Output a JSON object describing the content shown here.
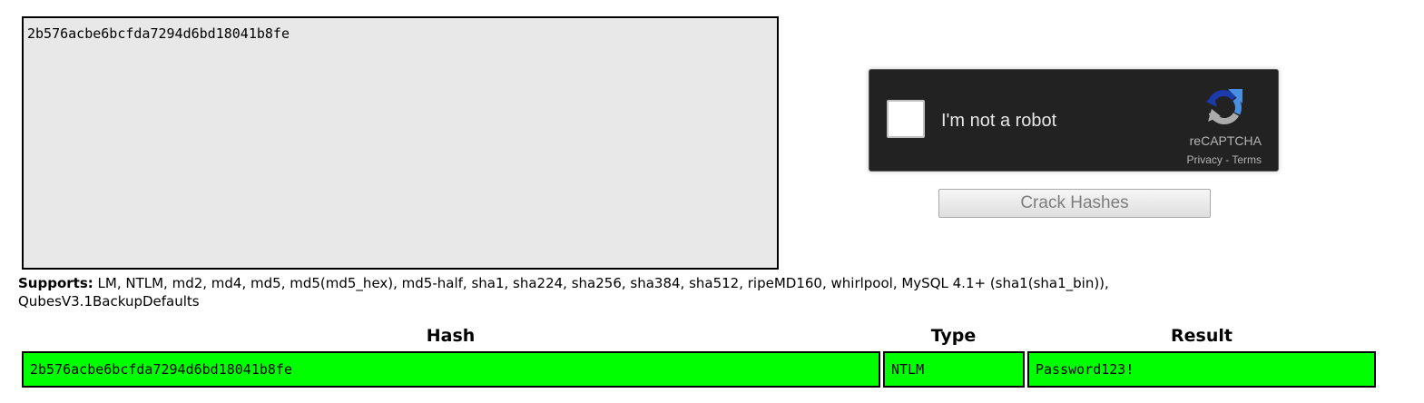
{
  "hash_input": {
    "value": "2b576acbe6bcfda7294d6bd18041b8fe"
  },
  "captcha": {
    "label": "I'm not a robot",
    "brand": "reCAPTCHA",
    "privacy_link": "Privacy",
    "separator": " - ",
    "terms_link": "Terms",
    "logo_icon": "recaptcha-logo-icon",
    "colors": {
      "background": "#222222",
      "logo_blue": "#4a90e2",
      "logo_dark_blue": "#1c3aa9",
      "logo_gray": "#ababab"
    }
  },
  "crack_button": {
    "label": "Crack Hashes"
  },
  "supports": {
    "label": "Supports:",
    "text": " LM, NTLM, md2, md4, md5, md5(md5_hex), md5-half, sha1, sha224, sha256, sha384, sha512, ripeMD160, whirlpool, MySQL 4.1+ (sha1(sha1_bin)), QubesV3.1BackupDefaults"
  },
  "results_table": {
    "headers": {
      "hash": "Hash",
      "type": "Type",
      "result": "Result"
    },
    "rows": [
      {
        "hash": "2b576acbe6bcfda7294d6bd18041b8fe",
        "type": "NTLM",
        "result": "Password123!",
        "status_color": "#00ff00"
      }
    ]
  }
}
